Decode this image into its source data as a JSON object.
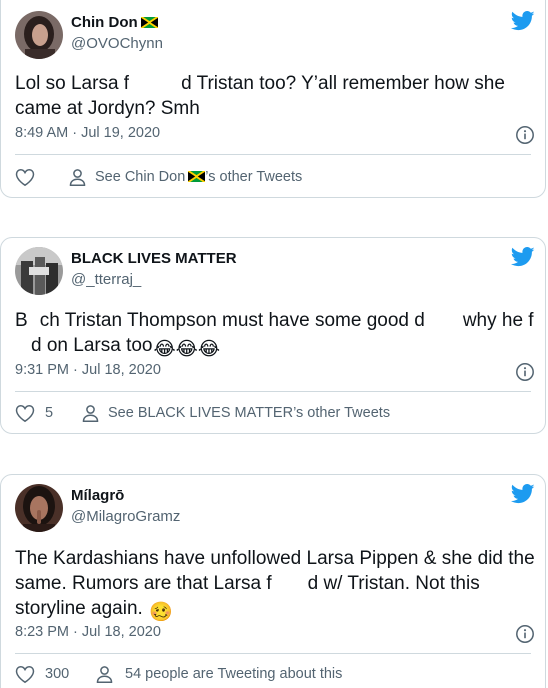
{
  "tweets": [
    {
      "name": "Chin Don",
      "handle": "@OVOChynn",
      "text_parts": [
        "Lol so Larsa f",
        "d Tristan too? Y’all remember how she came at Jordyn? Smh"
      ],
      "timestamp": "8:49 AM · Jul 19, 2020",
      "footer_prefix": "See Chin Don",
      "footer_suffix": "’s other Tweets"
    },
    {
      "name": "BLACK LIVES MATTER",
      "handle": "@_tterraj_",
      "text_parts": [
        "B",
        "ch Tristan Thompson must have some good d",
        "why he f",
        "d on Larsa too"
      ],
      "emojis": "😂😂😂",
      "timestamp": "9:31 PM · Jul 18, 2020",
      "like_count": "5",
      "footer_text": "See BLACK LIVES MATTER’s other Tweets"
    },
    {
      "name": "Mílagrō",
      "handle": "@MilagroGramz",
      "text_parts": [
        "The Kardashians have unfollowed Larsa Pippen & she did the same. Rumors are that Larsa f",
        "d w/ Tristan. Not this storyline again."
      ],
      "emoji": "🥴",
      "timestamp": "8:23 PM · Jul 18, 2020",
      "like_count": "300",
      "footer_text": "54 people are Tweeting about this"
    }
  ],
  "icons": {
    "brand": "twitter-bird-icon",
    "info": "info-icon",
    "like": "heart-icon",
    "profile": "person-icon",
    "flag": "jamaica-flag-icon"
  },
  "colors": {
    "brand_blue": "#1d9bf0",
    "text": "#0f1419",
    "secondary": "#536471",
    "border": "#cfd9de"
  }
}
